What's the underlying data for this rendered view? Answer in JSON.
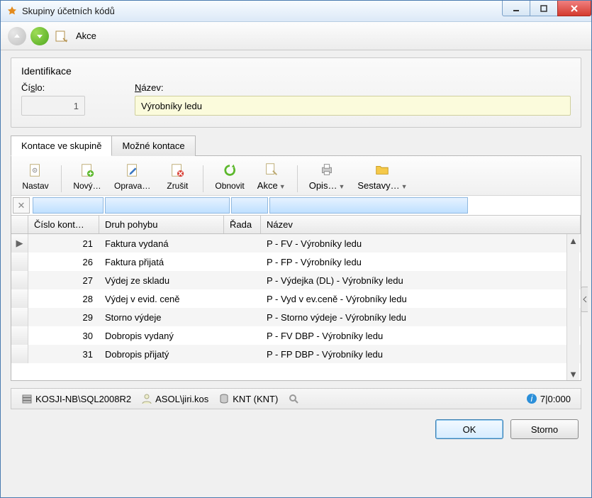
{
  "window": {
    "title": "Skupiny účetních kódů"
  },
  "actionbar": {
    "akce": "Akce"
  },
  "form": {
    "section_title": "Identifikace",
    "cislo_label_pre": "Čí",
    "cislo_label_u": "s",
    "cislo_label_post": "lo:",
    "cislo_value": "1",
    "nazev_label_u": "N",
    "nazev_label_post": "ázev:",
    "nazev_value": "Výrobníky ledu"
  },
  "tabs": {
    "active": "Kontace ve skupině",
    "inactive": "Možné kontace"
  },
  "toolbar": {
    "nastav": "Nastav",
    "novy": "Nový…",
    "oprava": "Oprava…",
    "zrusit": "Zrušit",
    "obnovit": "Obnovit",
    "akce": "Akce",
    "opis": "Opis…",
    "sestavy": "Sestavy…"
  },
  "grid": {
    "headers": {
      "cislo": "Číslo kont…",
      "druh": "Druh pohybu",
      "rada": "Řada",
      "nazev": "Název"
    },
    "rows": [
      {
        "cislo": "21",
        "druh": "Faktura vydaná",
        "rada": "",
        "nazev": "P - FV - Výrobníky ledu",
        "current": true
      },
      {
        "cislo": "26",
        "druh": "Faktura přijatá",
        "rada": "",
        "nazev": "P - FP - Výrobníky ledu"
      },
      {
        "cislo": "27",
        "druh": "Výdej ze skladu",
        "rada": "",
        "nazev": "P - Výdejka (DL) - Výrobníky ledu"
      },
      {
        "cislo": "28",
        "druh": "Výdej v evid. ceně",
        "rada": "",
        "nazev": "P - Vyd v ev.ceně - Výrobníky ledu"
      },
      {
        "cislo": "29",
        "druh": "Storno výdeje",
        "rada": "",
        "nazev": "P - Storno výdeje -  Výrobníky ledu"
      },
      {
        "cislo": "30",
        "druh": "Dobropis vydaný",
        "rada": "",
        "nazev": "P - FV DBP - Výrobníky ledu"
      },
      {
        "cislo": "31",
        "druh": "Dobropis přijatý",
        "rada": "",
        "nazev": "P - FP DBP - Výrobníky ledu"
      }
    ]
  },
  "statusbar": {
    "server": "KOSJI-NB\\SQL2008R2",
    "user": "ASOL\\jiri.kos",
    "db": "KNT (KNT)",
    "info": "7|0:000"
  },
  "buttons": {
    "ok": "OK",
    "storno": "Storno"
  }
}
